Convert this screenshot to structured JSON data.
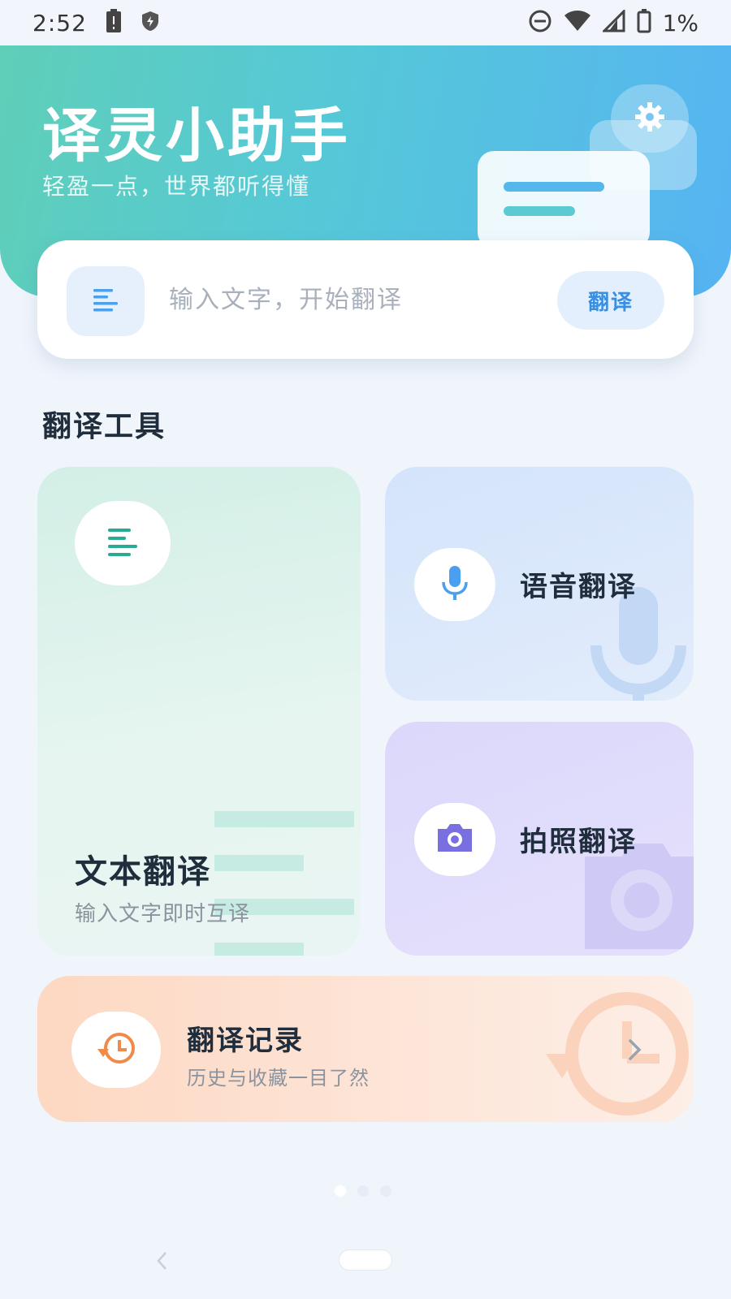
{
  "status_bar": {
    "time": "2:52",
    "battery_percent": "1%"
  },
  "header": {
    "title": "译灵小助手",
    "subtitle": "轻盈一点，世界都听得懂"
  },
  "search": {
    "placeholder": "输入文字，开始翻译",
    "button_label": "翻译"
  },
  "tools": {
    "section_title": "翻译工具",
    "text_card": {
      "title": "文本翻译",
      "subtitle": "输入文字即时互译",
      "icon": "text-lines-icon"
    },
    "voice_card": {
      "title": "语音翻译",
      "icon": "microphone-icon"
    },
    "photo_card": {
      "title": "拍照翻译",
      "icon": "camera-icon"
    },
    "history_card": {
      "title": "翻译记录",
      "subtitle": "历史与收藏一目了然",
      "icon": "history-icon"
    }
  },
  "pager": {
    "active_index": 0,
    "count": 3
  },
  "colors": {
    "header_start": "#5fcfb8",
    "header_end": "#56b4f2",
    "accent_blue": "#3b8fe0",
    "teal": "#2aa993",
    "purple": "#7a6fe0",
    "orange": "#f08a4b"
  }
}
